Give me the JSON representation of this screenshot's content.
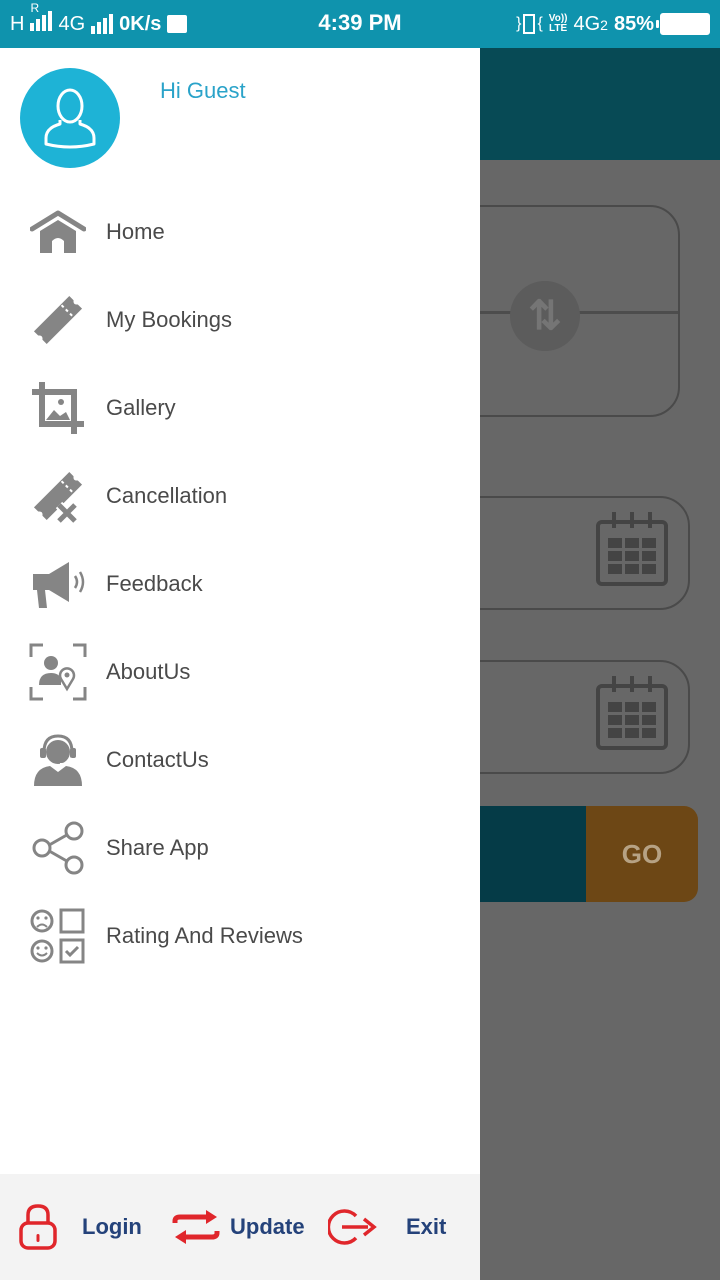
{
  "status_bar": {
    "left_network_1": "H",
    "left_roaming": "R",
    "left_network_2": "4G",
    "speed": "0K/s",
    "time": "4:39 PM",
    "volte_top": "Vo))",
    "volte_bottom": "LTE",
    "network_right": "4G",
    "sim_index": "2",
    "battery_percent": "85%",
    "battery_level": 0.85
  },
  "drawer": {
    "greeting": "Hi Guest",
    "avatar_icon": "user-outline-icon",
    "accent_color": "#1eb3d6",
    "menu": [
      {
        "label": "Home",
        "icon": "home-icon"
      },
      {
        "label": "My Bookings",
        "icon": "ticket-icon"
      },
      {
        "label": "Gallery",
        "icon": "gallery-crop-icon"
      },
      {
        "label": "Cancellation",
        "icon": "ticket-cancel-icon"
      },
      {
        "label": "Feedback",
        "icon": "megaphone-icon"
      },
      {
        "label": "AboutUs",
        "icon": "about-profile-icon"
      },
      {
        "label": "ContactUs",
        "icon": "headset-agent-icon"
      },
      {
        "label": "Share App",
        "icon": "share-icon"
      },
      {
        "label": "Rating And Reviews",
        "icon": "rating-review-icon"
      }
    ],
    "footer": {
      "login": {
        "label": "Login",
        "icon": "lock-icon"
      },
      "update": {
        "label": "Update",
        "icon": "swap-arrows-icon"
      },
      "exit": {
        "label": "Exit",
        "icon": "logout-icon"
      },
      "icon_color": "#e0262b",
      "label_color": "#24427a"
    }
  },
  "background_app": {
    "header_color": "#0a6d7e",
    "go_label": "GO",
    "go_color": "#f39c1f"
  }
}
